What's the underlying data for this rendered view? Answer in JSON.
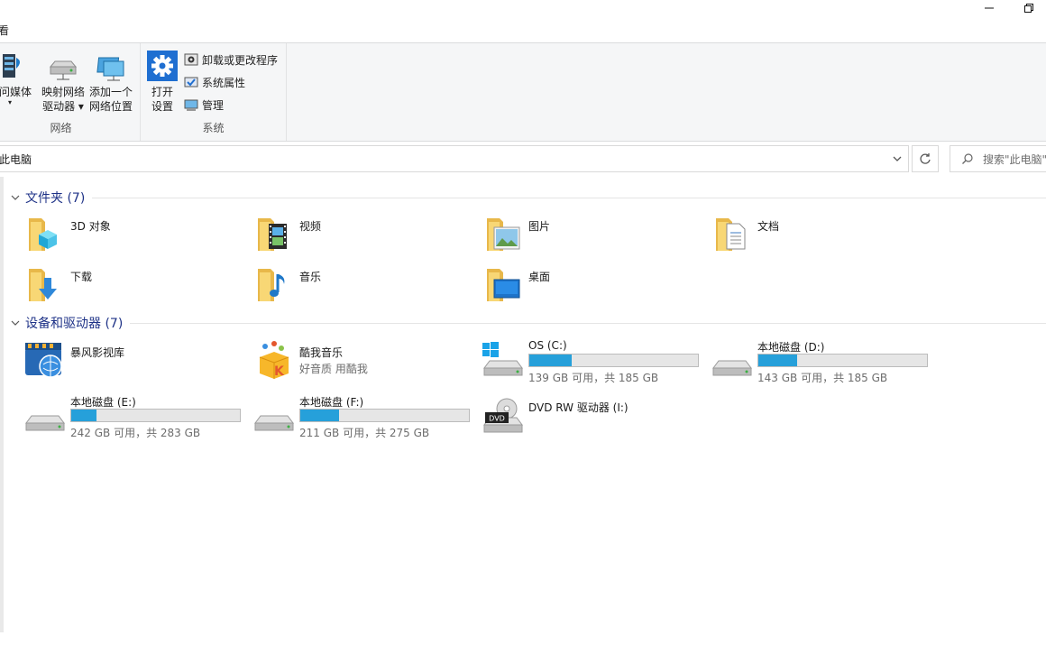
{
  "titlebar": {
    "tab_fragment": "看"
  },
  "ribbon": {
    "network": {
      "caption": "网络",
      "media_label": "访问媒体",
      "map_drive_line1": "映射网络",
      "map_drive_line2": "驱动器 ▾",
      "add_location_line1": "添加一个",
      "add_location_line2": "网络位置"
    },
    "system": {
      "caption": "系统",
      "open_settings_line1": "打开",
      "open_settings_line2": "设置",
      "uninstall_label": "卸载或更改程序",
      "properties_label": "系统属性",
      "manage_label": "管理"
    }
  },
  "address": {
    "path": "此电脑"
  },
  "search": {
    "placeholder": "搜索\"此电脑\""
  },
  "folders": {
    "title": "文件夹 (7)",
    "items": [
      {
        "name": "3D 对象",
        "icon": "3d-objects-folder-icon"
      },
      {
        "name": "视频",
        "icon": "videos-folder-icon"
      },
      {
        "name": "图片",
        "icon": "pictures-folder-icon"
      },
      {
        "name": "文档",
        "icon": "documents-folder-icon"
      },
      {
        "name": "下载",
        "icon": "downloads-folder-icon"
      },
      {
        "name": "音乐",
        "icon": "music-folder-icon"
      },
      {
        "name": "桌面",
        "icon": "desktop-folder-icon"
      }
    ]
  },
  "devices": {
    "title": "设备和驱动器 (7)",
    "apps": [
      {
        "name": "暴风影视库",
        "sub": ""
      },
      {
        "name": "酷我音乐",
        "sub": "好音质 用酷我"
      }
    ],
    "drives": [
      {
        "name": "OS (C:)",
        "free": "139 GB 可用，共 185 GB",
        "used_fraction": 0.25
      },
      {
        "name": "本地磁盘 (D:)",
        "free": "143 GB 可用，共 185 GB",
        "used_fraction": 0.23
      },
      {
        "name": "本地磁盘 (E:)",
        "free": "242 GB 可用，共 283 GB",
        "used_fraction": 0.15
      },
      {
        "name": "本地磁盘 (F:)",
        "free": "211 GB 可用，共 275 GB",
        "used_fraction": 0.23
      }
    ],
    "dvd": {
      "name": "DVD RW 驱动器 (I:)",
      "badge": "DVD"
    }
  },
  "colors": {
    "accent": "#26a0da",
    "section_title": "#1e3287",
    "folder": "#f8d775"
  }
}
